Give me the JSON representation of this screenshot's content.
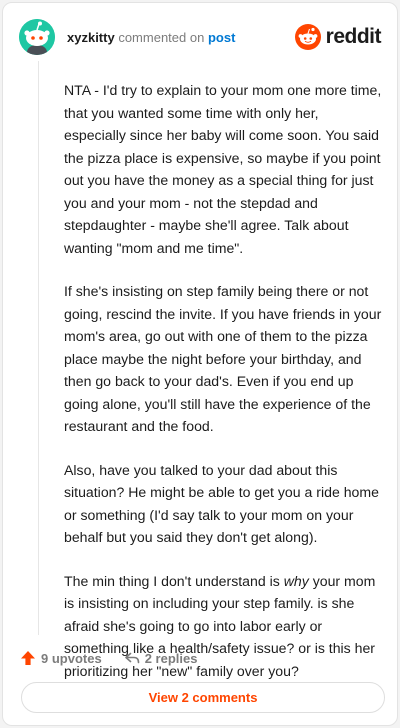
{
  "header": {
    "username": "xyzkitty",
    "action_text": "commented on",
    "post_link": "post",
    "brand_name": "reddit",
    "avatar_icon": "snoo-avatar-icon",
    "brand_icon": "reddit-alien-icon"
  },
  "comment": {
    "paragraphs": [
      "NTA - I'd try to explain to your mom one more time, that you wanted some time with only her, especially since her baby will come soon. You said the pizza place is expensive, so maybe if you point out you have the money as a special thing for just you and your mom - not the stepdad and stepdaughter - maybe she'll agree. Talk about wanting \"mom and me time\".",
      "If she's insisting on step family being there or not going, rescind the invite. If you have friends in your mom's area, go out with one of them to the pizza place maybe the night before your birthday, and then go back to your dad's. Even if you end up going alone, you'll still have the experience of the restaurant and the food.",
      "Also, have you talked to your dad about this situation? He might be able to get you a ride home or something (I'd say talk to your mom on your behalf but you said they don't get along).",
      {
        "before": "The min thing I don't understand is ",
        "emphasis": "why",
        "after": " your mom is insisting on including your step family. is she afraid she's going to go into labor early or something like a health/safety issue? or is this her prioritizing her \"new\" family over you?"
      }
    ]
  },
  "actions": {
    "upvotes_label": "9 upvotes",
    "replies_label": "2 replies",
    "upvote_icon": "upvote-arrow-icon",
    "reply_icon": "reply-arrow-icon"
  },
  "footer": {
    "view_comments_label": "View 2 comments"
  },
  "colors": {
    "brand": "#ff4500",
    "link": "#0079d3",
    "avatar_bg": "#1fc7a3",
    "text": "#1c1c1c",
    "muted": "#7c7c7c"
  }
}
